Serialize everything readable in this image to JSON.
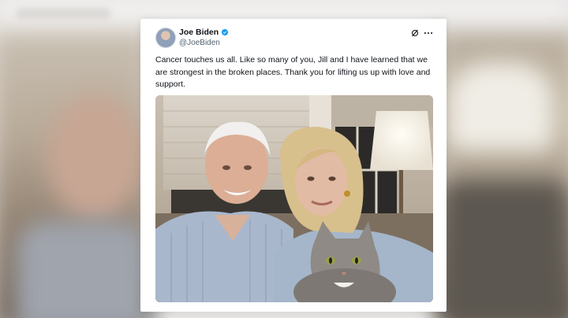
{
  "tweet": {
    "author_name": "Joe Biden",
    "author_handle": "@JoeBiden",
    "text": "Cancer touches us all. Like so many of you, Jill and I have learned that we are strongest in the broken places. Thank you for lifting us up with love and support.",
    "verified": true
  },
  "icons": {
    "verified": "verified-badge-icon",
    "grok": "grok-icon",
    "more": "more-options-icon"
  },
  "colors": {
    "verified_blue": "#1d9bf0",
    "text_primary": "#0f1419",
    "text_secondary": "#536471"
  }
}
